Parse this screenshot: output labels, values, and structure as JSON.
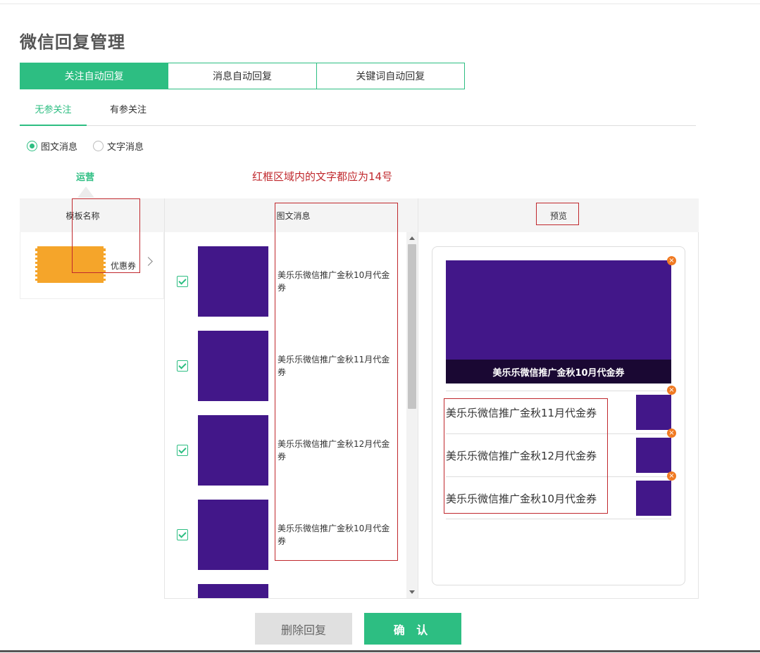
{
  "page_title": "微信回复管理",
  "tabs": [
    {
      "label": "关注自动回复",
      "active": true
    },
    {
      "label": "消息自动回复",
      "active": false
    },
    {
      "label": "关键词自动回复",
      "active": false
    }
  ],
  "subtabs": [
    {
      "label": "无参关注",
      "active": true
    },
    {
      "label": "有参关注",
      "active": false
    }
  ],
  "radios": [
    {
      "label": "图文消息",
      "checked": true
    },
    {
      "label": "文字消息",
      "checked": false
    }
  ],
  "ops_label": "运营",
  "annotation": "红框区域内的文字都应为14号",
  "headers": {
    "template_name": "模板名称",
    "news_message": "图文消息",
    "preview": "预览"
  },
  "template": {
    "label": "优惠券",
    "icon": "chevron-right-icon"
  },
  "news_items": [
    {
      "title": "美乐乐微信推广金秋10月代金券",
      "checked": true
    },
    {
      "title": "美乐乐微信推广金秋11月代金券",
      "checked": true
    },
    {
      "title": "美乐乐微信推广金秋12月代金券",
      "checked": true
    },
    {
      "title": "美乐乐微信推广金秋10月代金券",
      "checked": true
    }
  ],
  "preview": {
    "hero_title": "美乐乐微信推广金秋10月代金券",
    "rows": [
      "美乐乐微信推广金秋11月代金券",
      "美乐乐微信推广金秋12月代金券",
      "美乐乐微信推广金秋10月代金券"
    ]
  },
  "buttons": {
    "delete": "删除回复",
    "confirm": "确 认"
  },
  "colors": {
    "accent": "#2dbe82",
    "thumb": "#421789",
    "coupon": "#f5a52a",
    "annotation": "#c0282d",
    "remove": "#f07a22"
  }
}
